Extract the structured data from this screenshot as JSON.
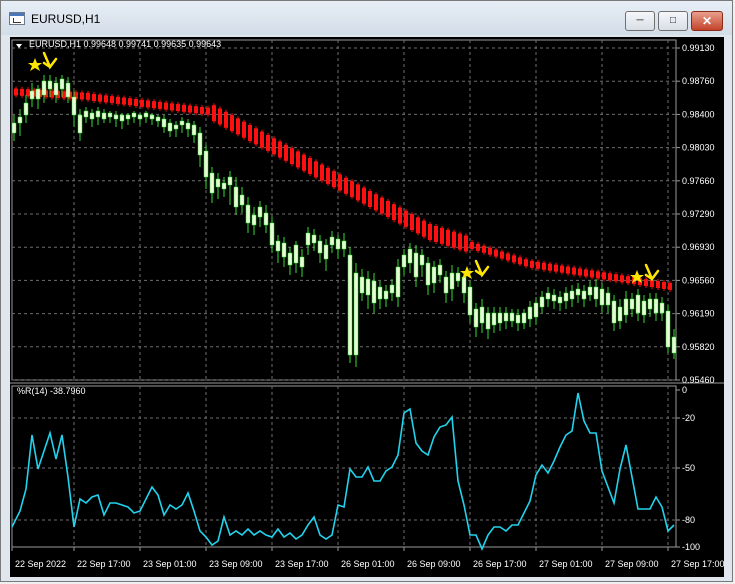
{
  "window": {
    "title": "EURUSD,H1"
  },
  "chart": {
    "symbol_info": "EURUSD,H1  0.99648 0.99741 0.99635 0.99643",
    "indicator_info": "%R(14) -38.7960",
    "price_ticks": [
      "0.99130",
      "0.98760",
      "0.98400",
      "0.98030",
      "0.97660",
      "0.97290",
      "0.96930",
      "0.96560",
      "0.96190",
      "0.95820",
      "0.95460"
    ],
    "wpr_ticks": [
      "0",
      "-20",
      "-50",
      "-80",
      "-100"
    ],
    "time_labels": [
      "22 Sep 2022",
      "22 Sep 17:00",
      "23 Sep 01:00",
      "23 Sep 09:00",
      "23 Sep 17:00",
      "26 Sep 01:00",
      "26 Sep 09:00",
      "26 Sep 17:00",
      "27 Sep 01:00",
      "27 Sep 09:00",
      "27 Sep 17:00"
    ],
    "colors": {
      "background": "#000000",
      "grid": "#6e6e6e",
      "bull": "#e8ffd8",
      "bear": "#33ff33",
      "wick": "#33dd33",
      "ma": "#ff1010",
      "wpr": "#22d3ee",
      "signal": "#ffe600",
      "text": "#ffffff"
    }
  }
}
